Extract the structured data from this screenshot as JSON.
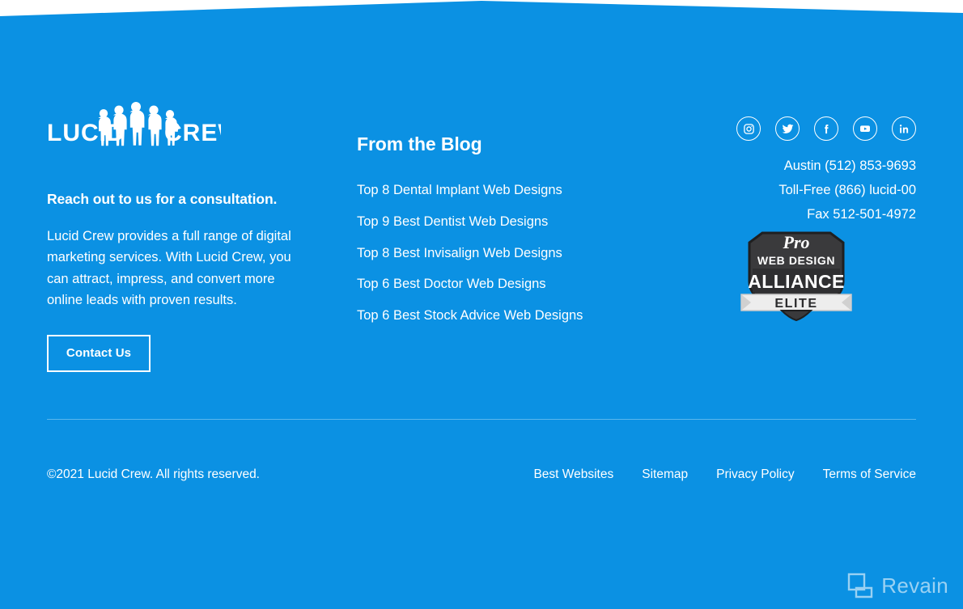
{
  "theme": {
    "background_blue": "#0b91e3",
    "text_white": "#ffffff",
    "divider": "#5bb7ec",
    "badge_dark": "#3a3a3c",
    "badge_ribbon": "#e9e9e9"
  },
  "brand": {
    "logo_left_text": "LUCID",
    "logo_right_text": "CREW",
    "logo_alt": "Lucid Crew logo with five people silhouettes"
  },
  "left_column": {
    "heading": "Reach out to us for a consultation.",
    "body": "Lucid Crew provides a full range of digital marketing services. With Lucid Crew, you can attract, impress, and convert more online leads with proven results.",
    "cta_label": "Contact Us"
  },
  "blog": {
    "title": "From the Blog",
    "posts": [
      {
        "label": "Top 8 Dental Implant Web Designs"
      },
      {
        "label": "Top 9 Best Dentist Web Designs"
      },
      {
        "label": "Top 8 Best Invisalign Web Designs"
      },
      {
        "label": "Top 6 Best Doctor Web Designs"
      },
      {
        "label": "Top 6 Best Stock Advice Web Designs"
      }
    ]
  },
  "social": [
    {
      "name": "instagram-icon",
      "label": "Instagram"
    },
    {
      "name": "twitter-icon",
      "label": "Twitter"
    },
    {
      "name": "facebook-icon",
      "label": "Facebook"
    },
    {
      "name": "youtube-icon",
      "label": "YouTube"
    },
    {
      "name": "linkedin-icon",
      "label": "LinkedIn"
    }
  ],
  "contact": {
    "lines": [
      {
        "label": "Austin (512) 853-9693"
      },
      {
        "label": "Toll-Free (866) lucid-00"
      },
      {
        "label": "Fax 512-501-4972"
      }
    ]
  },
  "badge": {
    "line1": "Pro",
    "line2": "WEB DESIGN",
    "line3": "ALLIANCE",
    "line4": "ELITE"
  },
  "bottom_bar": {
    "copyright": "©2021 Lucid Crew. All rights reserved.",
    "links": [
      {
        "label": "Best Websites"
      },
      {
        "label": "Sitemap"
      },
      {
        "label": "Privacy Policy"
      },
      {
        "label": "Terms of Service"
      }
    ]
  },
  "watermark": {
    "text": "Revain"
  }
}
